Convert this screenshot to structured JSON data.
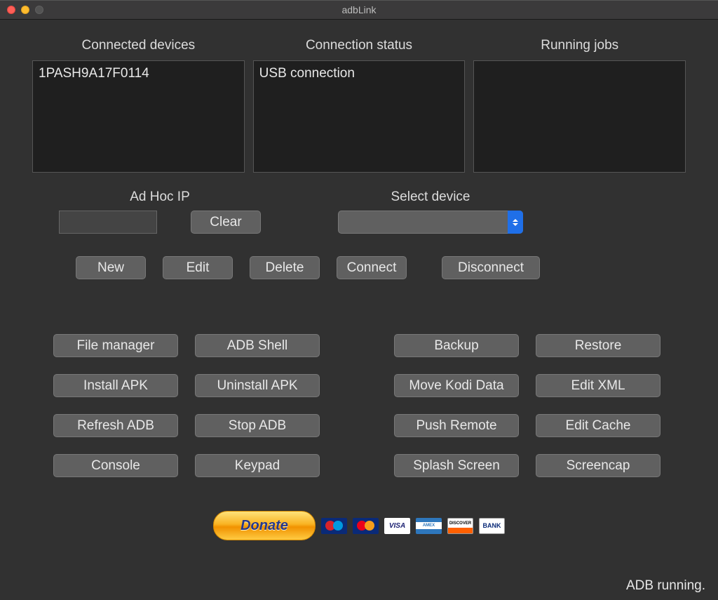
{
  "window": {
    "title": "adbLink"
  },
  "panels": {
    "connected": {
      "label": "Connected devices",
      "items": [
        "1PASH9A17F0114"
      ]
    },
    "status": {
      "label": "Connection status",
      "items": [
        "USB connection"
      ]
    },
    "jobs": {
      "label": "Running jobs",
      "items": []
    }
  },
  "adhoc": {
    "label": "Ad Hoc IP",
    "value": "",
    "clear": "Clear"
  },
  "select": {
    "label": "Select device",
    "value": ""
  },
  "device_buttons": {
    "new": "New",
    "edit": "Edit",
    "delete": "Delete",
    "connect": "Connect",
    "disconnect": "Disconnect"
  },
  "tools": {
    "file_manager": "File manager",
    "adb_shell": "ADB Shell",
    "backup": "Backup",
    "restore": "Restore",
    "install_apk": "Install APK",
    "uninstall_apk": "Uninstall APK",
    "move_kodi": "Move Kodi Data",
    "edit_xml": "Edit XML",
    "refresh_adb": "Refresh ADB",
    "stop_adb": "Stop ADB",
    "push_remote": "Push Remote",
    "edit_cache": "Edit Cache",
    "console": "Console",
    "keypad": "Keypad",
    "splash": "Splash Screen",
    "screencap": "Screencap"
  },
  "donate": {
    "label": "Donate"
  },
  "cards": {
    "visa": "VISA",
    "bank": "BANK",
    "discover": "DISCOVER",
    "amex": "AMEX"
  },
  "statusbar": {
    "text": "ADB running."
  }
}
